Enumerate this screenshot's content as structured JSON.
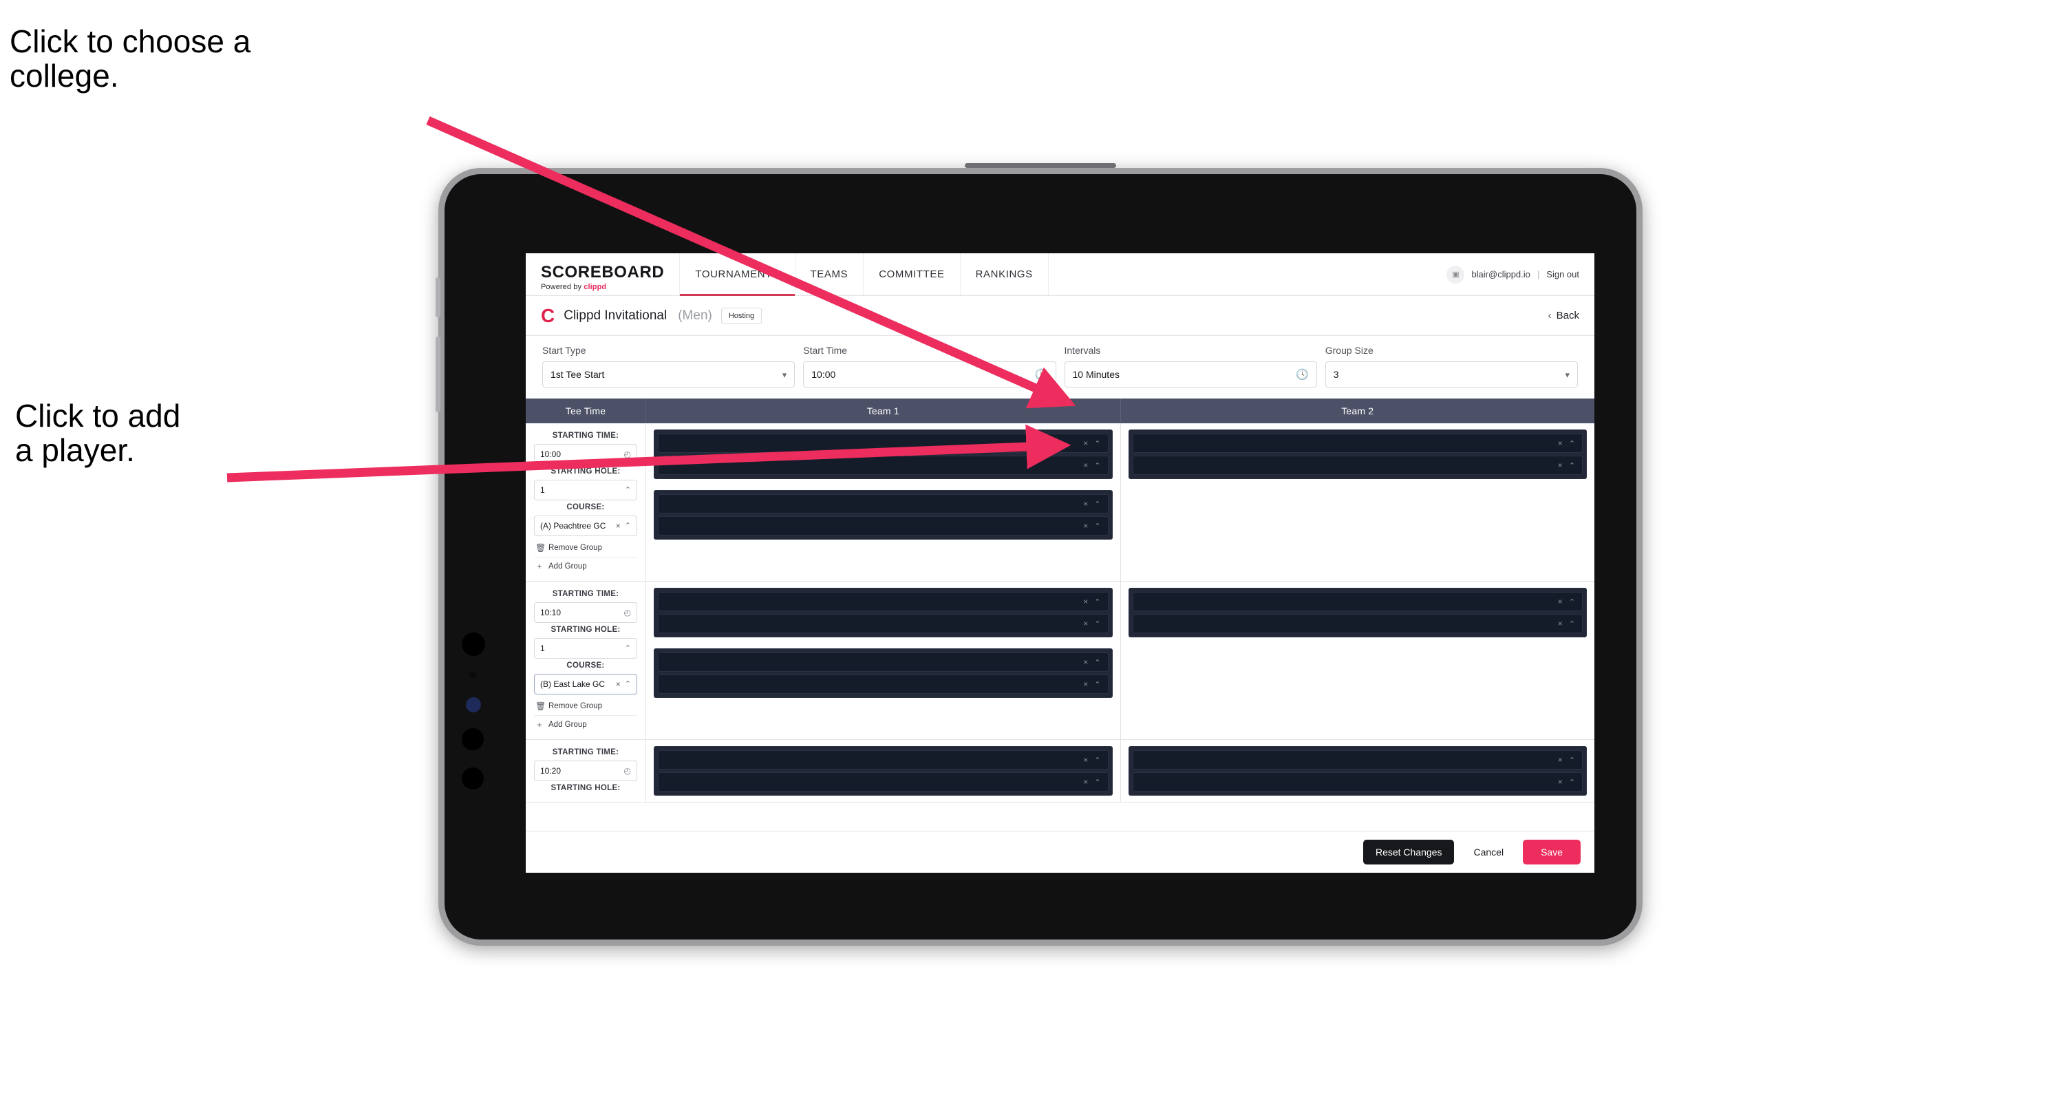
{
  "annotations": {
    "choose_college": "Click to choose a\ncollege.",
    "add_player": "Click to add\na player."
  },
  "colors": {
    "accent_pink": "#ec2d5d",
    "annotation_arrow": "#ec2d5d",
    "table_header": "#4c5167",
    "slot_dark": "#151c29"
  },
  "navbar": {
    "brand_top": "SCOREBOARD",
    "brand_sub_prefix": "Powered by",
    "brand_sub_name": "clippd",
    "tabs": [
      {
        "label": "TOURNAMENTS",
        "active": true
      },
      {
        "label": "TEAMS",
        "active": false
      },
      {
        "label": "COMMITTEE",
        "active": false
      },
      {
        "label": "RANKINGS",
        "active": false
      }
    ],
    "account_icon": "user-avatar-icon",
    "email": "blair@clippd.io",
    "separator": "|",
    "sign_out": "Sign out"
  },
  "tournament": {
    "logo_letter": "C",
    "title": "Clippd Invitational",
    "gender": "(Men)",
    "status_pill": "Hosting",
    "back_label": "Back",
    "back_icon": "chevron-left-icon"
  },
  "settings": {
    "fields": [
      {
        "label": "Start Type",
        "value": "1st Tee Start",
        "icon": "stepper-icon"
      },
      {
        "label": "Start Time",
        "value": "10:00",
        "icon": "clock-icon"
      },
      {
        "label": "Intervals",
        "value": "10 Minutes",
        "icon": "clock-icon"
      },
      {
        "label": "Group Size",
        "value": "3",
        "icon": "stepper-icon"
      }
    ]
  },
  "table": {
    "headers": [
      {
        "label": "Tee Time"
      },
      {
        "label": "Team 1"
      },
      {
        "label": "Team 2"
      }
    ],
    "field_labels": {
      "starting_time": "STARTING TIME:",
      "starting_hole": "STARTING HOLE:",
      "course": "COURSE:"
    },
    "group_actions": {
      "remove": "Remove Group",
      "remove_icon": "trash-icon",
      "add": "Add Group",
      "add_icon": "plus-icon"
    },
    "slot_icons": {
      "clear": "×",
      "stepper": "⌃⌄"
    },
    "rows": [
      {
        "starting_time": "10:00",
        "starting_hole": "1",
        "course": "(A) Peachtree GC",
        "course_focused": false,
        "team1_blocks": [
          2,
          2
        ],
        "team2_blocks": [
          2
        ]
      },
      {
        "starting_time": "10:10",
        "starting_hole": "1",
        "course": "(B) East Lake GC",
        "course_focused": true,
        "team1_blocks": [
          2,
          2
        ],
        "team2_blocks": [
          2
        ]
      },
      {
        "starting_time": "10:20",
        "starting_hole": "",
        "course": "",
        "course_focused": false,
        "team1_blocks": [
          2
        ],
        "team2_blocks": [
          2
        ]
      }
    ]
  },
  "footer": {
    "reset": "Reset Changes",
    "cancel": "Cancel",
    "save": "Save"
  }
}
